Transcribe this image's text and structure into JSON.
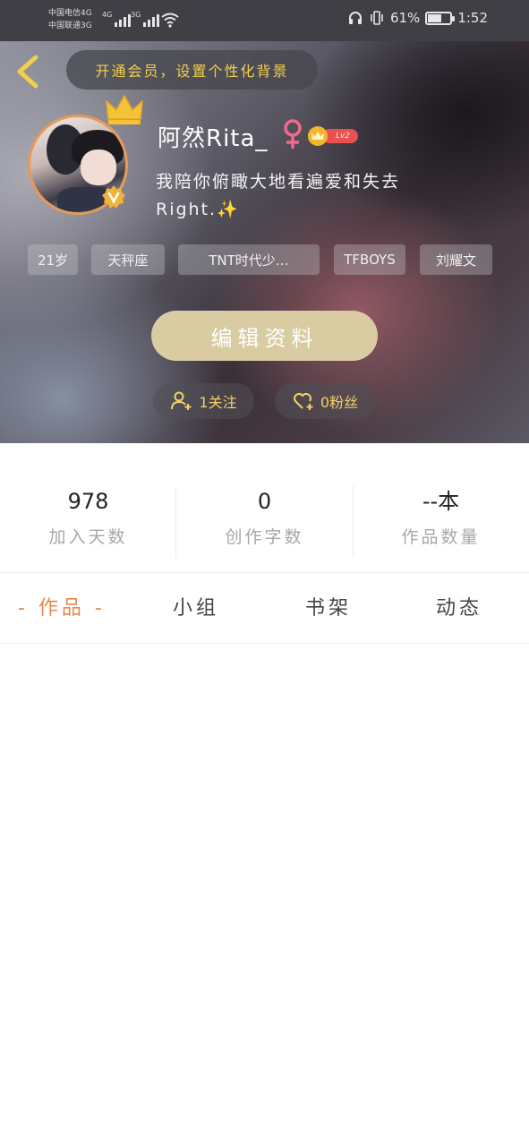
{
  "status_bar": {
    "carrier_1": "中国电信4G",
    "carrier_2": "中国联通3G",
    "net_type_1": "4G",
    "net_type_2": "3G",
    "battery_percent": "61%",
    "battery_level": 0.61,
    "time": "1:52",
    "icons": [
      "signal-icon",
      "wifi-icon",
      "headphone-icon",
      "vibrate-icon",
      "battery-icon"
    ]
  },
  "header": {
    "vip_banner": "开通会员，设置个性化背景",
    "username": "阿然Rita_",
    "gender_symbol": "♀",
    "level": "Lv2",
    "bio_line_1": "我陪你俯瞰大地看遍爱和失去",
    "bio_line_2": "Right.",
    "bio_emoji": "✨",
    "tags": [
      "21岁",
      "天秤座",
      "TNT时代少…",
      "TFBOYS",
      "刘耀文"
    ],
    "edit_profile_label": "编辑资料",
    "following_label": "1关注",
    "fans_label": "0粉丝",
    "colors": {
      "accent_yellow": "#f4cf4a",
      "edit_button": "#d9cca3",
      "level_red": "#e9504f"
    }
  },
  "stats": [
    {
      "value": "978",
      "label": "加入天数"
    },
    {
      "value": "0",
      "label": "创作字数"
    },
    {
      "value": "--本",
      "label": "作品数量"
    }
  ],
  "tabs": [
    {
      "label": "- 作品 -",
      "active": true
    },
    {
      "label": "小组",
      "active": false
    },
    {
      "label": "书架",
      "active": false
    },
    {
      "label": "动态",
      "active": false
    }
  ],
  "colors": {
    "active_tab": "#e7884a",
    "stat_label": "#a7a7a7"
  }
}
